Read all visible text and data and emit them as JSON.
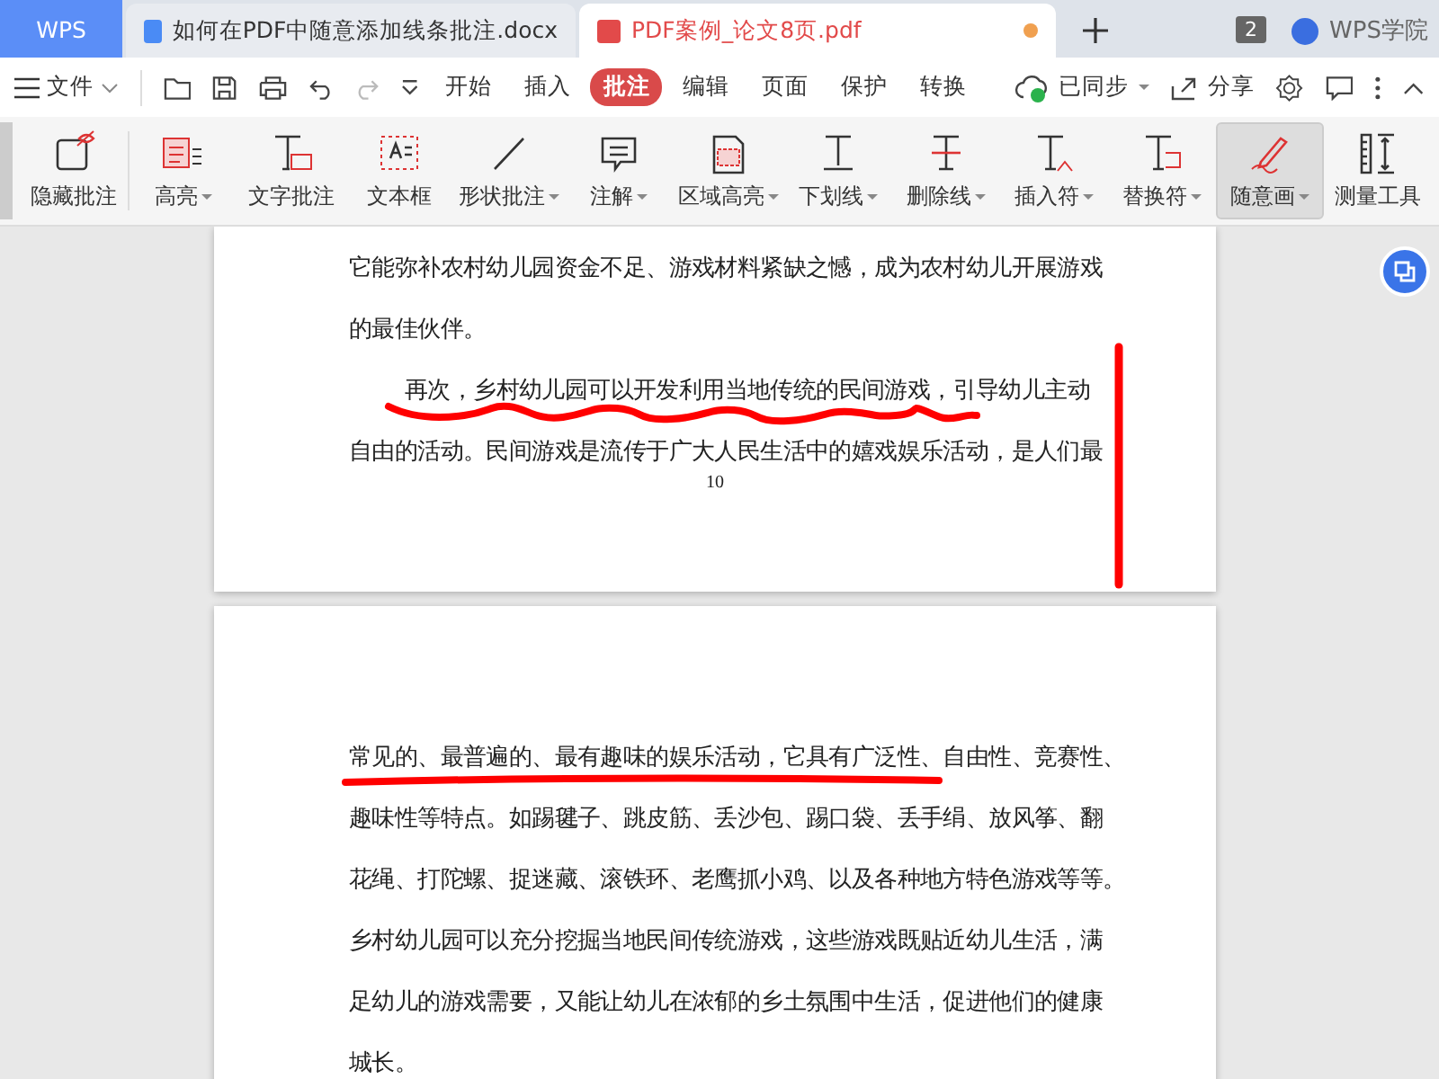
{
  "tabs": [
    {
      "kind": "home",
      "label": "WPS",
      "selected": false
    },
    {
      "kind": "word",
      "label": "如何在PDF中随意添加线条批注.docx",
      "selected": false,
      "modified": false
    },
    {
      "kind": "pdf",
      "label": "PDF案例_论文8页.pdf",
      "selected": true,
      "modified": true
    }
  ],
  "window_count": "2",
  "academy": {
    "label": "WPS学院"
  },
  "menu": {
    "file": "文件",
    "tabs": [
      {
        "label": "开始",
        "selected": false
      },
      {
        "label": "插入",
        "selected": false
      },
      {
        "label": "批注",
        "selected": true
      },
      {
        "label": "编辑",
        "selected": false
      },
      {
        "label": "页面",
        "selected": false
      },
      {
        "label": "保护",
        "selected": false
      },
      {
        "label": "转换",
        "selected": false
      }
    ],
    "sync": "已同步",
    "share": "分享"
  },
  "ribbon": [
    {
      "label": "隐藏批注",
      "dropdown": false,
      "selected": false
    },
    {
      "label": "高亮",
      "dropdown": true,
      "selected": false
    },
    {
      "label": "文字批注",
      "dropdown": false,
      "selected": false
    },
    {
      "label": "文本框",
      "dropdown": false,
      "selected": false
    },
    {
      "label": "形状批注",
      "dropdown": true,
      "selected": false
    },
    {
      "label": "注解",
      "dropdown": true,
      "selected": false
    },
    {
      "label": "区域高亮",
      "dropdown": true,
      "selected": false
    },
    {
      "label": "下划线",
      "dropdown": true,
      "selected": false
    },
    {
      "label": "删除线",
      "dropdown": true,
      "selected": false
    },
    {
      "label": "插入符",
      "dropdown": true,
      "selected": false
    },
    {
      "label": "替换符",
      "dropdown": true,
      "selected": false
    },
    {
      "label": "随意画",
      "dropdown": true,
      "selected": true
    },
    {
      "label": "测量工具",
      "dropdown": false,
      "selected": false
    }
  ],
  "pages": [
    {
      "lines": [
        {
          "text": "它能弥补农村幼儿园资金不足、游戏材料紧缺之憾，成为农村幼儿开展游戏",
          "indent": false
        },
        {
          "text": "的最佳伙伴。",
          "indent": false
        },
        {
          "text": "再次，乡村幼儿园可以开发利用当地传统的民间游戏，引导幼儿主动",
          "indent": true
        },
        {
          "text": "自由的活动。民间游戏是流传于广大人民生活中的嬉戏娱乐活动，是人们最",
          "indent": false
        }
      ],
      "page_number": "10"
    },
    {
      "lines": [
        {
          "text": "常见的、最普遍的、最有趣味的娱乐活动，它具有广泛性、自由性、竞赛性、",
          "indent": false
        },
        {
          "text": "趣味性等特点。如踢毽子、跳皮筋、丢沙包、踢口袋、丢手绢、放风筝、翻",
          "indent": false
        },
        {
          "text": "花绳、打陀螺、捉迷藏、滚铁环、老鹰抓小鸡、以及各种地方特色游戏等等。",
          "indent": false
        },
        {
          "text": "乡村幼儿园可以充分挖掘当地民间传统游戏，这些游戏既贴近幼儿生活，满",
          "indent": false
        },
        {
          "text": "足幼儿的游戏需要，又能让幼儿在浓郁的乡土氛围中生活，促进他们的健康",
          "indent": false
        },
        {
          "text": "城长。",
          "indent": false
        }
      ]
    }
  ]
}
